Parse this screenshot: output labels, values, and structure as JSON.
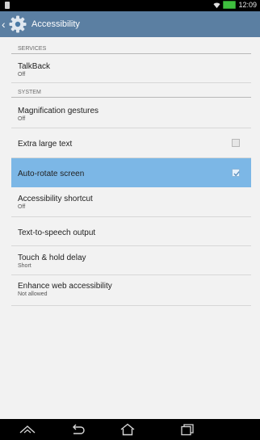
{
  "status_bar": {
    "time": "12:09",
    "icons": [
      "notification-icon",
      "wifi-icon",
      "battery-icon"
    ],
    "battery_color": "#3fbf3f"
  },
  "action_bar": {
    "title": "Accessibility",
    "color": "#5b7fa2"
  },
  "sections": {
    "services": "SERVICES",
    "system": "SYSTEM"
  },
  "items": {
    "talkback": {
      "title": "TalkBack",
      "subtitle": "Off"
    },
    "magnification": {
      "title": "Magnification gestures",
      "subtitle": "Off"
    },
    "large_text": {
      "title": "Extra large text",
      "checked": false
    },
    "auto_rotate": {
      "title": "Auto-rotate screen",
      "checked": true,
      "selected": true
    },
    "shortcut": {
      "title": "Accessibility shortcut",
      "subtitle": "Off"
    },
    "tts": {
      "title": "Text-to-speech output"
    },
    "touch_hold": {
      "title": "Touch & hold delay",
      "subtitle": "Short"
    },
    "web": {
      "title": "Enhance web accessibility",
      "subtitle": "Not allowed"
    }
  },
  "nav_bar": {
    "buttons": [
      "recent-apps-up-icon",
      "back-icon",
      "home-icon",
      "recent-apps-icon"
    ]
  },
  "highlight_color": "#7cb7e6"
}
